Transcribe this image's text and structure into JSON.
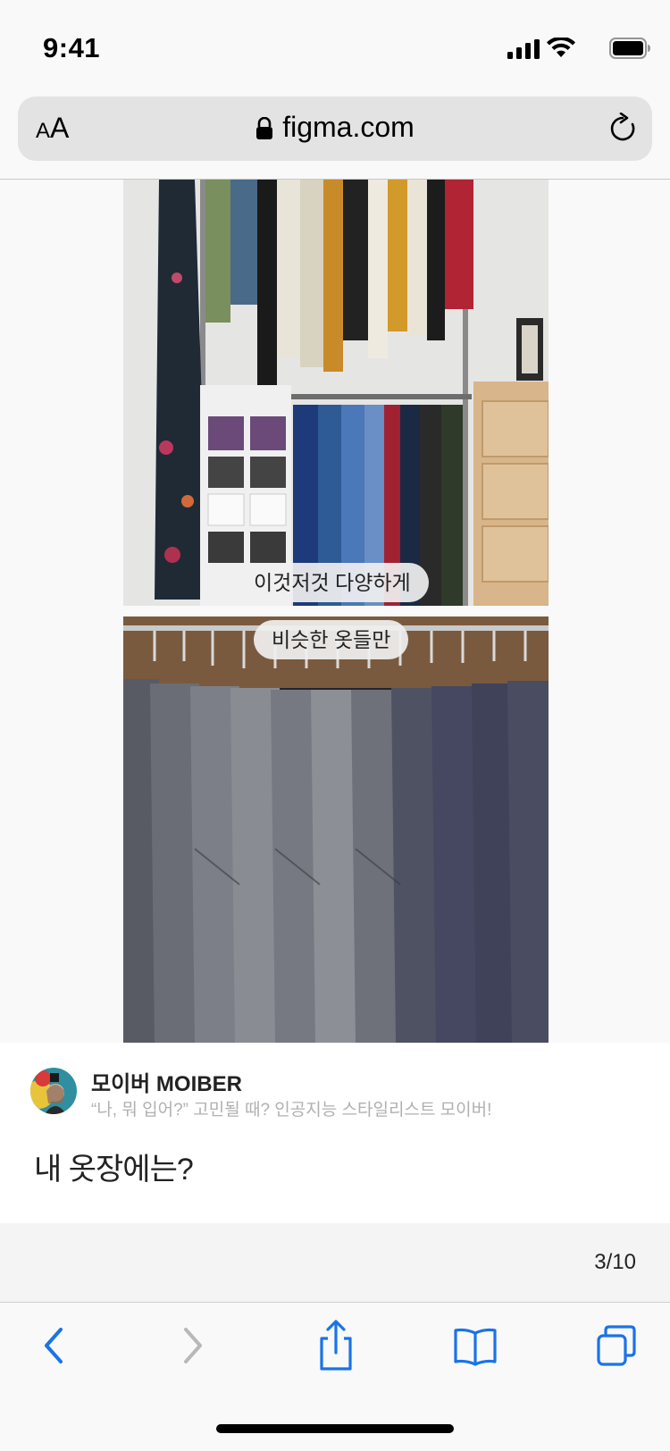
{
  "status_bar": {
    "time": "9:41"
  },
  "url_bar": {
    "aa_small": "A",
    "aa_big": "A",
    "domain": "figma.com"
  },
  "content": {
    "photo_1_caption": "이것저것 다양하게",
    "photo_2_caption": "비슷한 옷들만"
  },
  "card": {
    "profile_name": "모이버 MOIBER",
    "profile_tagline": "“나, 뭐 입어?” 고민될 때? 인공지능 스타일리스트 모이버!",
    "post_title": "내 옷장에는?"
  },
  "pagination": {
    "label": "3/10"
  },
  "toolbar": {
    "icons": [
      "back-icon",
      "forward-icon",
      "share-icon",
      "bookmarks-icon",
      "tabs-icon"
    ],
    "accent_color": "#1a73e8",
    "disabled_color": "#b8b8b8"
  }
}
